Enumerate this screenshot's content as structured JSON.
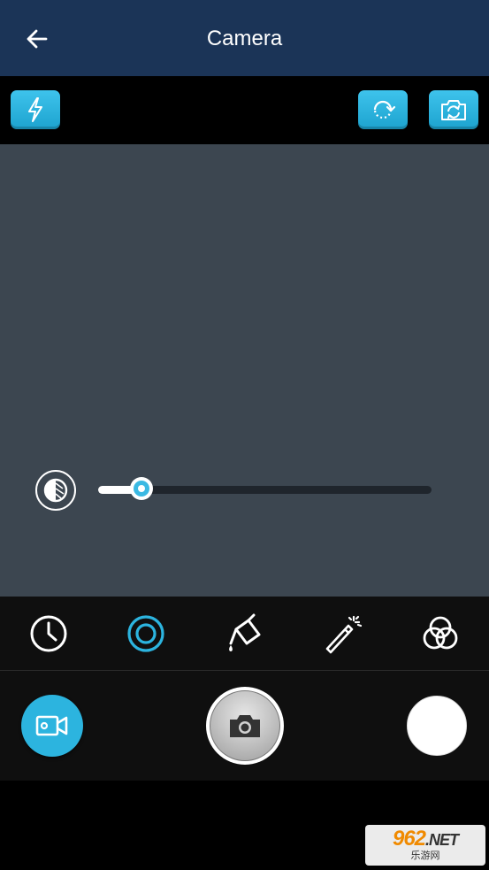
{
  "app_bar": {
    "title": "Camera",
    "background": "#1b3457"
  },
  "top_tools": {
    "icons": [
      "flash-icon",
      "rotate-icon",
      "switch-camera-icon"
    ],
    "accent": "#2cb4df"
  },
  "viewfinder": {
    "background": "#3c4650"
  },
  "exposure": {
    "icon": "exposure-icon",
    "value_fraction": 0.13
  },
  "filters": {
    "items": [
      "timer-icon",
      "focus-icon",
      "paint-bucket-icon",
      "magic-wand-icon",
      "color-filter-icon"
    ],
    "active": "focus-icon"
  },
  "capture": {
    "video_icon": "video-camera-icon",
    "shutter_icon": "camera-icon",
    "gallery": "gallery-thumbnail"
  },
  "watermark": {
    "logo_number": "962",
    "logo_net": ".NET",
    "subtitle": "乐游网"
  }
}
